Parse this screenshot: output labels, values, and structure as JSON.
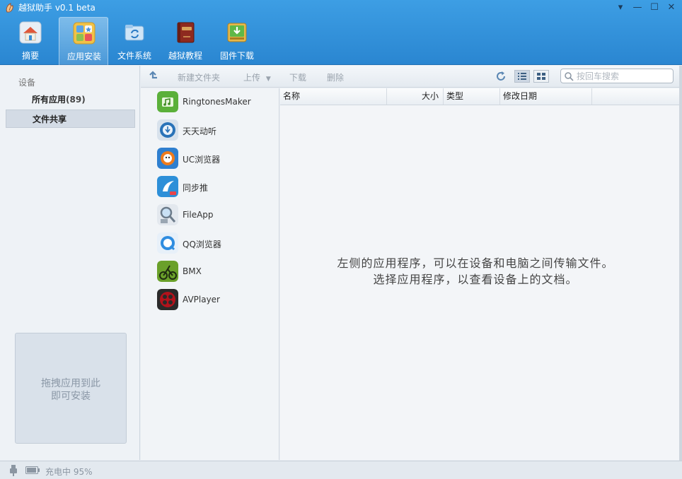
{
  "window": {
    "title": "越狱助手 v0.1 beta",
    "controls": [
      "menu-icon",
      "minimize-icon",
      "maximize-icon",
      "close-icon"
    ]
  },
  "nav": {
    "items": [
      {
        "label": "摘要",
        "icon": "home-icon"
      },
      {
        "label": "应用安装",
        "icon": "apps-icon",
        "active": true
      },
      {
        "label": "文件系统",
        "icon": "folder-sync-icon"
      },
      {
        "label": "越狱教程",
        "icon": "book-icon"
      },
      {
        "label": "固件下载",
        "icon": "download-icon"
      }
    ]
  },
  "left": {
    "section_label": "设备",
    "all_apps_label": "所有应用",
    "all_apps_count": "(89)",
    "file_share_label": "文件共享",
    "drop_line1": "拖拽应用到此",
    "drop_line2": "即可安装"
  },
  "toolbar": {
    "new_folder": "新建文件夹",
    "upload": "上传",
    "download": "下载",
    "delete": "删除",
    "search_placeholder": "按回车搜索"
  },
  "apps": [
    {
      "name": "RingtonesMaker",
      "icon": "ringtone-app-icon",
      "color": "#5bb03a"
    },
    {
      "name": "天天动听",
      "icon": "ttpod-app-icon",
      "color": "#2a73b8"
    },
    {
      "name": "UC浏览器",
      "icon": "uc-browser-app-icon",
      "color": "#f07b1c"
    },
    {
      "name": "同步推",
      "icon": "tongbutui-app-icon",
      "color": "#2d8fd8"
    },
    {
      "name": "FileApp",
      "icon": "fileapp-app-icon",
      "color": "#9aa6b2"
    },
    {
      "name": "QQ浏览器",
      "icon": "qq-browser-app-icon",
      "color": "#2f8de0"
    },
    {
      "name": "BMX",
      "icon": "bmx-app-icon",
      "color": "#6aa02a"
    },
    {
      "name": "AVPlayer",
      "icon": "avplayer-app-icon",
      "color": "#b3121b"
    }
  ],
  "table": {
    "columns": [
      "名称",
      "大小",
      "类型",
      "修改日期"
    ],
    "empty_line1": "左侧的应用程序，可以在设备和电脑之间传输文件。",
    "empty_line2": "选择应用程序，以查看设备上的文档。"
  },
  "status": {
    "text": "充电中 95%"
  },
  "colors": {
    "accent": "#2a86d1",
    "panel": "#eef2f6",
    "selected": "#d3dbe5"
  }
}
